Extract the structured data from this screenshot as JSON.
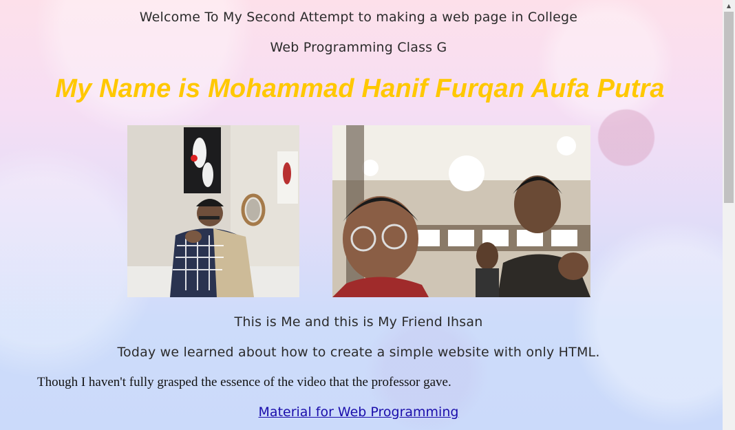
{
  "page": {
    "welcome_text": "Welcome To My Second Attempt to making a web page in College",
    "class_text": "Web Programming Class G",
    "name_heading": "My Name is Mohammad Hanif Furqan Aufa Putra",
    "caption_text": "This is Me and this is My Friend Ihsan",
    "learned_text": "Today we learned about how to create a simple website with only HTML.",
    "grasp_text": "Though I haven't fully grasped the essence of the video that the professor gave.",
    "link_text": "Material for Web Programming"
  },
  "images": {
    "me": "photo of me",
    "friend": "selfie photo with friend"
  },
  "colors": {
    "heading": "#ffc800",
    "link": "#1a0dab",
    "text": "#2b2b2b"
  },
  "scrollbar": {
    "up_icon": "up-arrow-icon"
  }
}
